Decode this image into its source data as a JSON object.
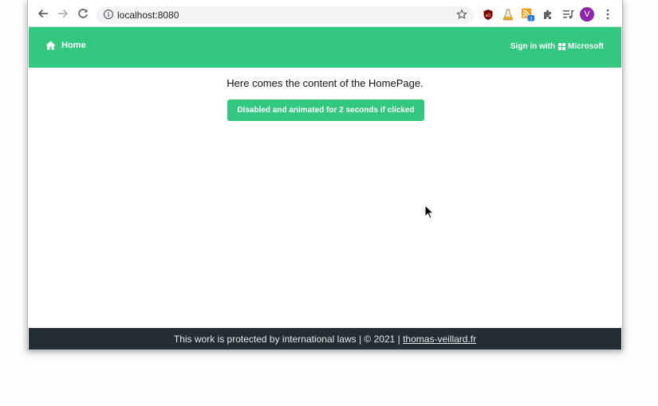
{
  "browser": {
    "url": "localhost:8080",
    "avatar_letter": "V",
    "rss_badge": "3",
    "icons": [
      "back-icon",
      "forward-icon",
      "reload-icon",
      "info-icon",
      "star-icon",
      "ublock-icon",
      "flask-icon",
      "rss-icon",
      "puzzle-icon",
      "media-icon",
      "avatar",
      "menu-icon"
    ]
  },
  "navbar": {
    "home_label": "Home",
    "signin_prefix": "Sign in with",
    "signin_provider": "Microsoft",
    "color": "#33c87f"
  },
  "content": {
    "text": "Here comes the content of the HomePage.",
    "button_label": "Disabled and animated for 2 seconds if clicked"
  },
  "footer": {
    "text": "This work is protected by international laws | © 2021 |",
    "link": "thomas-veillard.fr",
    "color": "#222e33"
  }
}
